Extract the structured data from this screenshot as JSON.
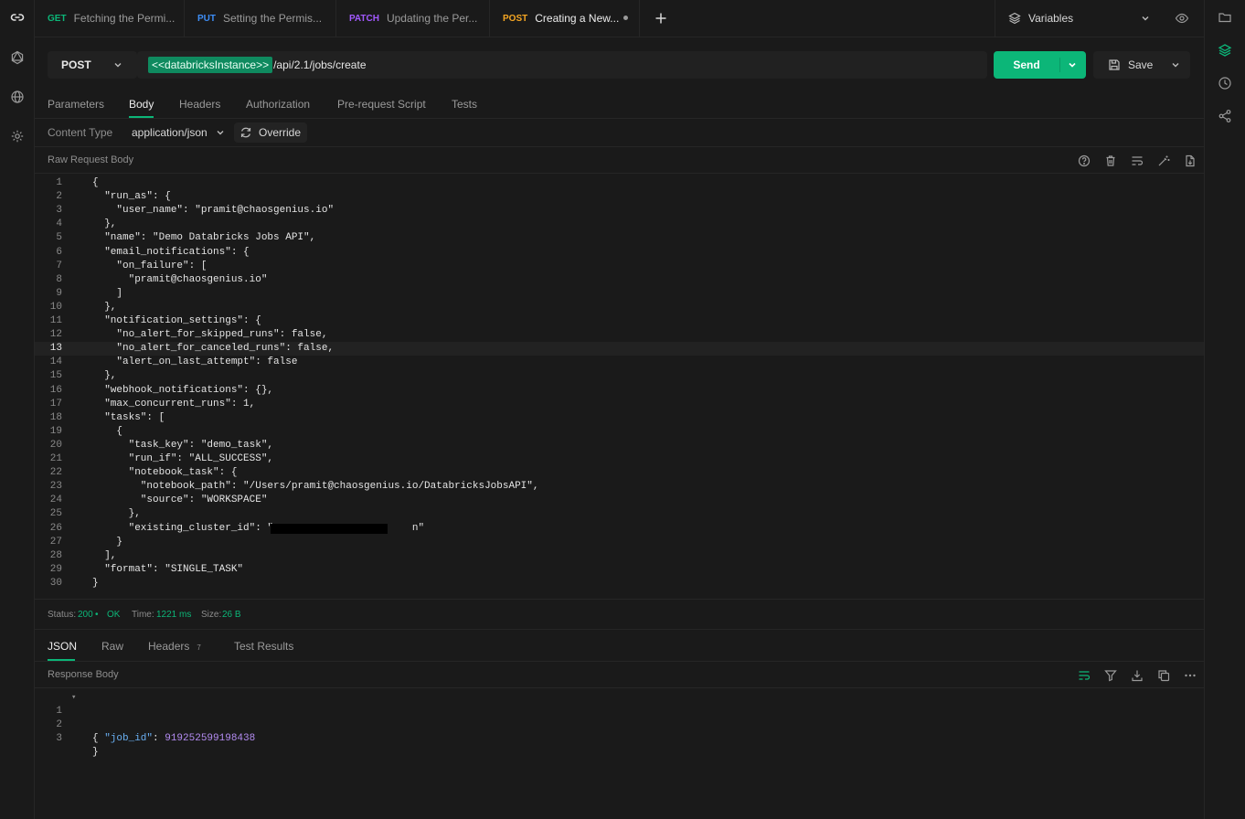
{
  "tabs": [
    {
      "method": "GET",
      "method_color": "#0cb678",
      "title": "Fetching the Permi..."
    },
    {
      "method": "PUT",
      "method_color": "#3e8ef7",
      "title": "Setting the Permis..."
    },
    {
      "method": "PATCH",
      "method_color": "#a259ff",
      "title": "Updating the Per..."
    },
    {
      "method": "POST",
      "method_color": "#f5a623",
      "title": "Creating a New..."
    }
  ],
  "variables_label": "Variables",
  "request": {
    "method": "POST",
    "url_var": "<<databricksInstance>>",
    "url_path": "/api/2.1/jobs/create",
    "send_label": "Send",
    "save_label": "Save"
  },
  "request_tabs": [
    "Parameters",
    "Body",
    "Headers",
    "Authorization",
    "Pre-request Script",
    "Tests"
  ],
  "content_type": {
    "label": "Content Type",
    "value": "application/json",
    "override_label": "Override"
  },
  "body_section_title": "Raw Request Body",
  "body_lines": [
    "{",
    "  \"run_as\": {",
    "    \"user_name\": \"pramit@chaosgenius.io\"",
    "  },",
    "  \"name\": \"Demo Databricks Jobs API\",",
    "  \"email_notifications\": {",
    "    \"on_failure\": [",
    "      \"pramit@chaosgenius.io\"",
    "    ]",
    "  },",
    "  \"notification_settings\": {",
    "    \"no_alert_for_skipped_runs\": false,",
    "    \"no_alert_for_canceled_runs\": false,",
    "    \"alert_on_last_attempt\": false",
    "  },",
    "  \"webhook_notifications\": {},",
    "  \"max_concurrent_runs\": 1,",
    "  \"tasks\": [",
    "    {",
    "      \"task_key\": \"demo_task\",",
    "      \"run_if\": \"ALL_SUCCESS\",",
    "      \"notebook_task\": {",
    "        \"notebook_path\": \"/Users/pramit@chaosgenius.io/DatabricksJobsAPI\",",
    "        \"source\": \"WORKSPACE\"",
    "      },",
    "      \"existing_cluster_id\": \"                       n\"",
    "    }",
    "  ],",
    "  \"format\": \"SINGLE_TASK\"",
    "}"
  ],
  "status": {
    "status_label": "Status:",
    "status_code": "200",
    "status_text": "OK",
    "time_label": "Time:",
    "time_value": "1221 ms",
    "size_label": "Size:",
    "size_value": "26 B"
  },
  "response_tabs": {
    "json": "JSON",
    "raw": "Raw",
    "headers": "Headers",
    "headers_count": "7",
    "test_results": "Test Results"
  },
  "response_section_title": "Response Body",
  "response": {
    "open_brace": "{",
    "key": "\"job_id\"",
    "colon": ": ",
    "value": "919252599198438",
    "close_brace": "}"
  }
}
